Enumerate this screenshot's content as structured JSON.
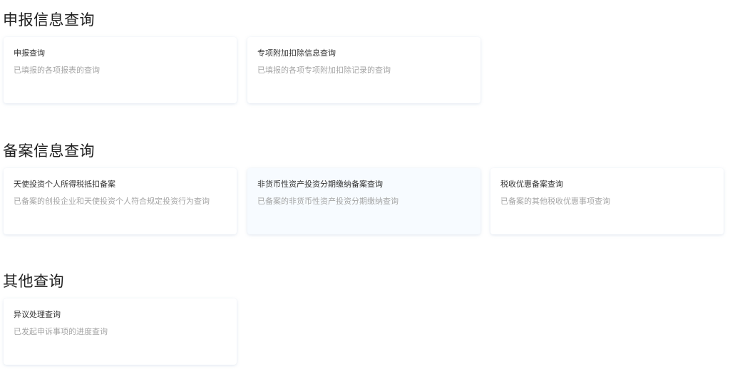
{
  "sections": [
    {
      "title": "申报信息查询",
      "cards": [
        {
          "title": "申报查询",
          "desc": "已填报的各项报表的查询"
        },
        {
          "title": "专项附加扣除信息查询",
          "desc": "已填报的各项专项附加扣除记录的查询"
        }
      ]
    },
    {
      "title": "备案信息查询",
      "cards": [
        {
          "title": "天使投资个人所得税抵扣备案",
          "desc": "已备案的创投企业和天使投资个人符合规定投资行为查询"
        },
        {
          "title": "非货币性资产投资分期缴纳备案查询",
          "desc": "已备案的非货币性资产投资分期缴纳查询"
        },
        {
          "title": "税收优惠备案查询",
          "desc": "已备案的其他税收优惠事项查询"
        }
      ]
    },
    {
      "title": "其他查询",
      "cards": [
        {
          "title": "异议处理查询",
          "desc": "已发起申诉事项的进度查询"
        }
      ]
    }
  ]
}
